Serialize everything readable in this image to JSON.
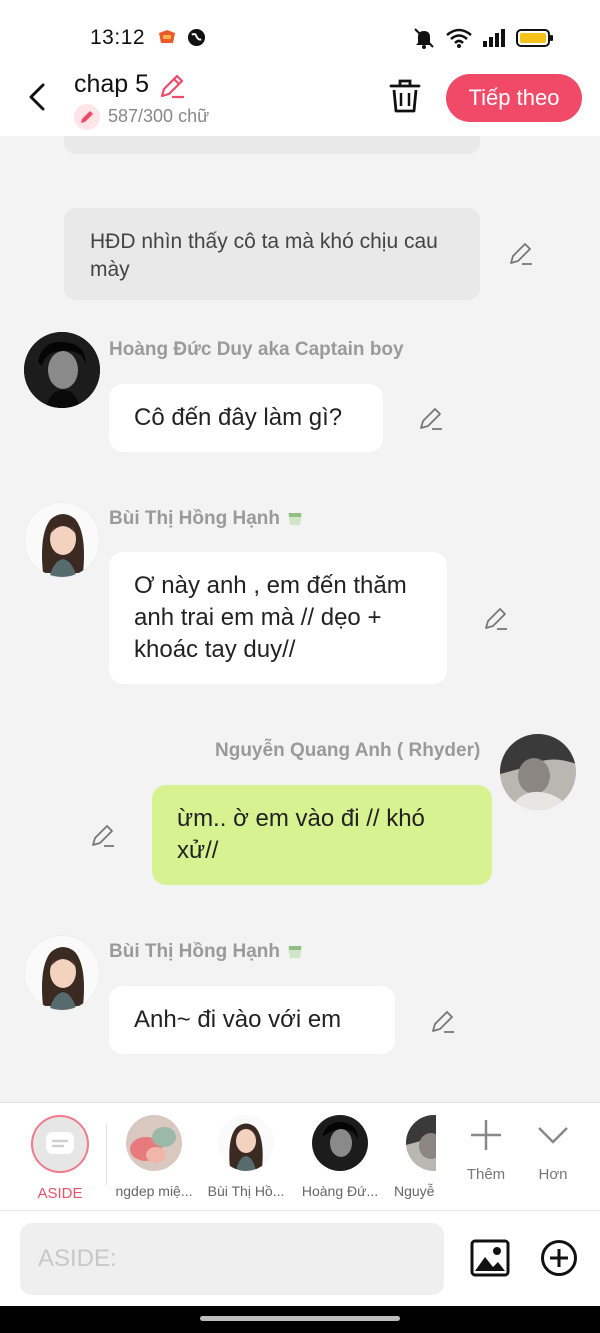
{
  "status_bar": {
    "time": "13:12"
  },
  "header": {
    "title": "chap 5",
    "word_count": "587/300 chữ",
    "next_label": "Tiếp theo",
    "accent_color": "#f04a68"
  },
  "chat": {
    "narration": "HĐD nhìn thấy cô ta mà khó chịu cau mày",
    "messages": [
      {
        "name": "Hoàng Đức Duy aka Captain boy",
        "text": "Cô đến đây làm gì?"
      },
      {
        "name": "Bùi Thị Hồng Hạnh",
        "text": "Ơ này anh , em đến thăm anh trai em mà // dẹo + khoác tay duy//"
      },
      {
        "name": "Nguyễn Quang Anh ( Rhyder)",
        "text": "ừm.. ờ em vào đi // khó xử//"
      },
      {
        "name": "Bùi Thị Hồng Hạnh",
        "text": "Anh~ đi vào với em"
      }
    ]
  },
  "character_bar": {
    "aside_label": "ASIDE",
    "characters": [
      "ngdep miệ...",
      "Bùi Thị Hồ...",
      "Hoàng Đứ...",
      "Nguyễ"
    ],
    "more_label": "Thêm",
    "expand_label": "Hơn"
  },
  "input": {
    "placeholder": "ASIDE:"
  },
  "icons": [
    "back-icon",
    "pencil-icon",
    "trash-icon",
    "image-icon",
    "plus-circle-icon",
    "add-icon",
    "chevron-down-icon",
    "tea-cup-icon"
  ]
}
